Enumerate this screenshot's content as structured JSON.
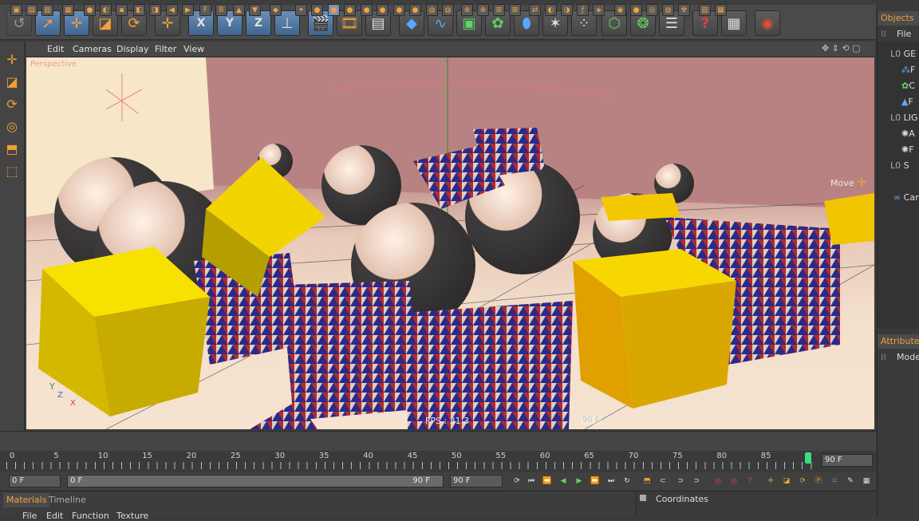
{
  "toolbar": {
    "buttons": [
      "undo-icon",
      "select-icon",
      "move-icon",
      "scale-icon",
      "rotate-icon",
      "add-icon",
      "x-axis-icon",
      "y-axis-icon",
      "z-axis-icon",
      "coordinate-system-icon",
      "render-view-icon",
      "render-picture-viewer-icon",
      "render-settings-icon",
      "cube-icon",
      "spline-icon",
      "nurbs-icon",
      "modeling-icon",
      "deformer-icon",
      "scene-icon",
      "particle-icon",
      "camera-icon",
      "light-icon",
      "layout-icon",
      "help-icon",
      "script-icon",
      "web-icon"
    ],
    "axis_labels": [
      "X",
      "Y",
      "Z"
    ],
    "help_glyph": "?"
  },
  "viewport": {
    "menu": [
      "Edit",
      "Cameras",
      "Display",
      "Filter",
      "View"
    ],
    "label": "Perspective",
    "fps": "FPS : 31.3",
    "frame": "90 F",
    "tool_hint": "Move",
    "axis": [
      "Y",
      "Z",
      "X"
    ]
  },
  "right_panel": {
    "objects_tab": "Objects",
    "file_menu": "File",
    "tree_items": [
      "GE",
      "F",
      "C",
      "F",
      "LIG",
      "A",
      "F",
      "S",
      "Car"
    ],
    "attributes_tab": "Attributes",
    "mode_menu": "Mode"
  },
  "timeline": {
    "ticks": [
      "0",
      "5",
      "10",
      "15",
      "20",
      "25",
      "30",
      "35",
      "40",
      "45",
      "50",
      "55",
      "60",
      "65",
      "70",
      "75",
      "80",
      "85"
    ],
    "end_frame": "90 F",
    "current_frame": "0 F",
    "min_field": "0 F",
    "max_field": "90 F",
    "range_end": "90 F",
    "playhead_frame": 90
  },
  "bottom": {
    "tabs": [
      "Materials",
      "Timeline"
    ],
    "menu": [
      "File",
      "Edit",
      "Function",
      "Texture"
    ],
    "coordinates": "Coordinates"
  },
  "colors": {
    "accent": "#f3a13a",
    "playhead": "#3ddc84"
  }
}
